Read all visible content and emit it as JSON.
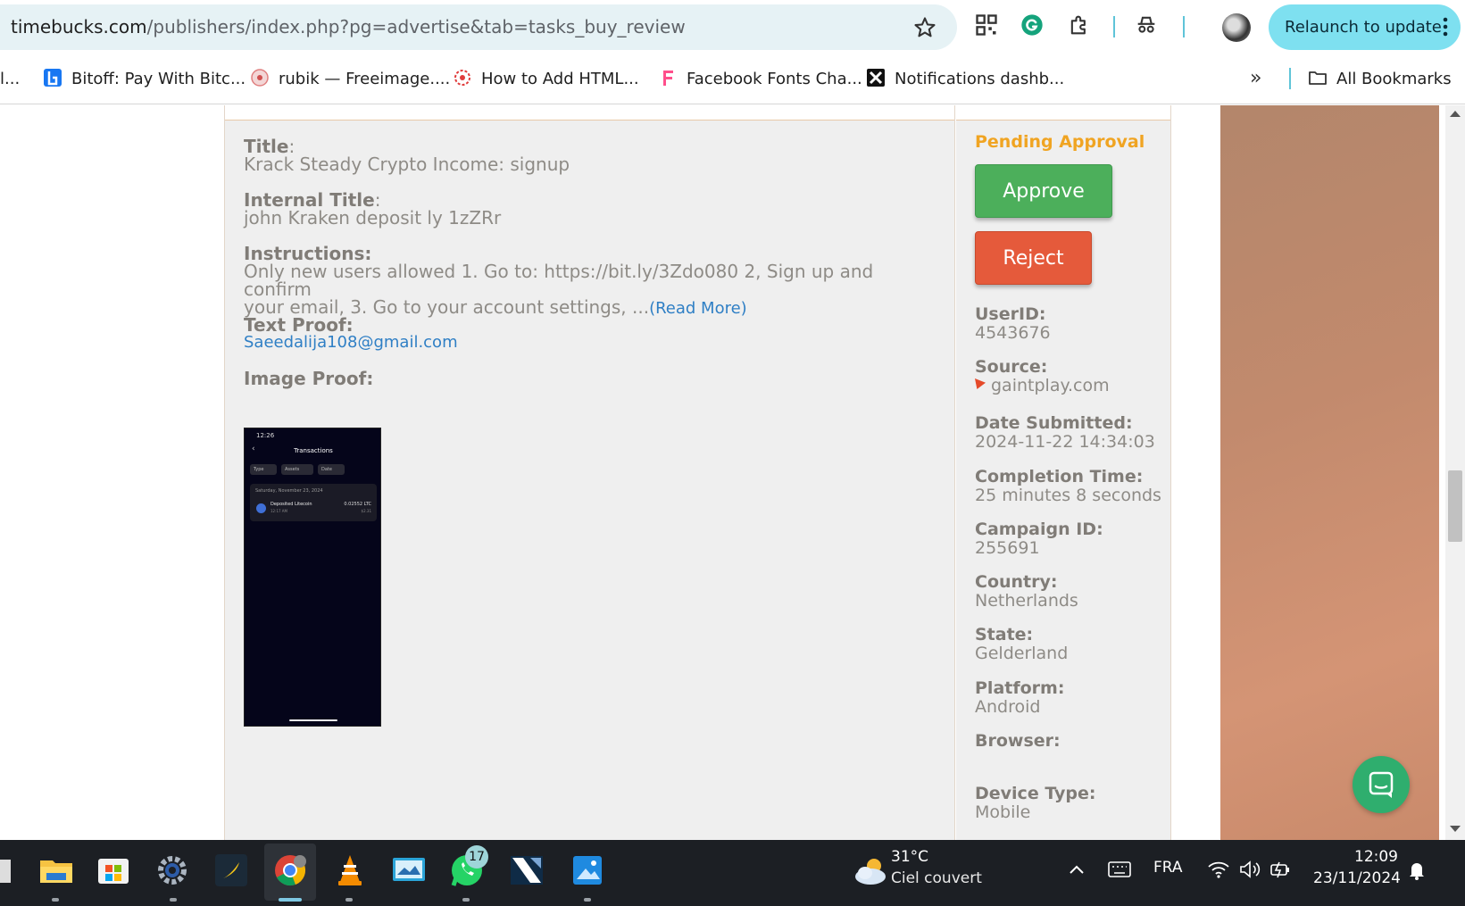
{
  "browser": {
    "url_domain": "timebucks.com",
    "url_path": "/publishers/index.php?pg=advertise&tab=tasks_buy_review",
    "relaunch_label": "Relaunch to update"
  },
  "bookmarks": {
    "items": [
      {
        "label": "Bitoff: Pay With Bitc...",
        "icon": "bitoff-icon"
      },
      {
        "label": "rubik — Freeimage....",
        "icon": "freeimage-icon"
      },
      {
        "label": "How to Add HTML...",
        "icon": "html-icon"
      },
      {
        "label": "Facebook Fonts Cha...",
        "icon": "fonts-icon"
      },
      {
        "label": "Notifications dashb...",
        "icon": "notifications-icon"
      }
    ],
    "all_bookmarks_label": "All Bookmarks"
  },
  "task": {
    "title_label": "Title",
    "title_value": "Krack Steady Crypto Income: signup",
    "internal_title_label": "Internal Title",
    "internal_title_value": "john Kraken deposit ly 1zZRr",
    "instructions_label": "Instructions:",
    "instructions_line1": "Only new users allowed 1. Go to: https://bit.ly/3Zdo080 2, Sign up and confirm",
    "instructions_line2": "your email, 3. Go to your account settings, ...",
    "read_more": "(Read More)",
    "text_proof_label": "Text Proof:",
    "text_proof_value": "Saeedalija108@gmail.com",
    "image_proof_label": "Image Proof:"
  },
  "proof_image": {
    "time": "12:26",
    "screen_title": "Transactions",
    "chips": [
      "Type",
      "Assets",
      "Date"
    ],
    "date": "Saturday, November 23, 2024",
    "entry": "Deposited Litecoin",
    "entry_time": "12:17 AM",
    "amount": "0.02552 LTC",
    "usd": "$2.31"
  },
  "review": {
    "status": "Pending Approval",
    "approve_label": "Approve",
    "reject_label": "Reject",
    "fields": [
      {
        "label": "UserID:",
        "value": "4543676"
      },
      {
        "label": "Source:",
        "value": "gaintplay.com"
      },
      {
        "label": "Date Submitted:",
        "value": "2024-11-22 14:34:03"
      },
      {
        "label": "Completion Time:",
        "value": "25 minutes 8 seconds"
      },
      {
        "label": "Campaign ID:",
        "value": "255691"
      },
      {
        "label": "Country:",
        "value": "Netherlands"
      },
      {
        "label": "State:",
        "value": "Gelderland"
      },
      {
        "label": "Platform:",
        "value": "Android"
      },
      {
        "label": "Browser:",
        "value": ""
      },
      {
        "label": "Device Type:",
        "value": "Mobile"
      }
    ]
  },
  "taskbar": {
    "weather_temp": "31°C",
    "weather_desc": "Ciel couvert",
    "language": "FRA",
    "time": "12:09",
    "date": "23/11/2024",
    "whatsapp_badge": "17"
  },
  "colors": {
    "status_pending": "#f0a422",
    "approve": "#4caf5b",
    "reject": "#e55a3b",
    "link": "#2f7fc5",
    "relaunch": "#7ee0f0"
  }
}
